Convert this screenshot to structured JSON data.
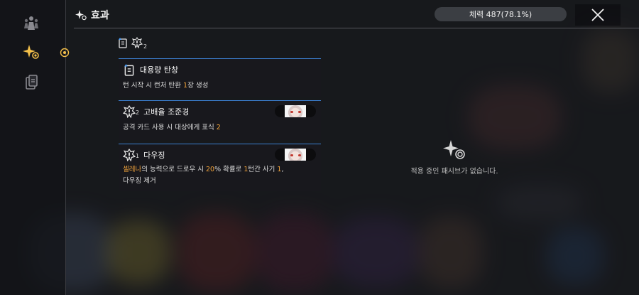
{
  "header": {
    "title": "효과",
    "hp_text": "체력 487(78.1%)",
    "close_icon": "close-x-icon"
  },
  "colors": {
    "accent_blue": "#3b7fd0",
    "highlight_orange": "#f0a23a",
    "active_gold": "#f4c04a"
  },
  "sidebar": {
    "items": [
      {
        "icon": "party-icon",
        "active": false
      },
      {
        "icon": "sparkle-effect-icon",
        "active": true
      },
      {
        "icon": "card-deck-icon",
        "active": false
      }
    ]
  },
  "summary": {
    "icons": [
      "scroll-card-icon",
      "exclamation-burst-icon"
    ],
    "count": "2"
  },
  "effects": [
    {
      "name": "대용량 탄창",
      "icon": "scroll-card-icon",
      "desc": {
        "pre": "턴 시작 시 런처 탄환 ",
        "num": "1",
        "post": "장 생성"
      }
    },
    {
      "name": "고배율 조준경",
      "icon": "exclamation-burst-icon",
      "icon_count": "2",
      "portrait": "white-haired-character-portrait",
      "desc": {
        "pre": "공격 카드 사용 시 대상에게 표식 ",
        "num": "2",
        "post": ""
      }
    },
    {
      "name": "다우징",
      "icon": "exclamation-burst-icon",
      "icon_count": "1",
      "portrait": "white-haired-character-portrait",
      "desc": {
        "name_hl": "셀레나",
        "t1": "의 능력으로 드로우 시 ",
        "pct": "20",
        "t2": "% 확률로 ",
        "turn": "1",
        "t3": "턴간 사기 ",
        "morale": "1",
        "t4": ",",
        "line2": "다우징 제거"
      }
    }
  ],
  "empty_state": {
    "icon": "sparkle-swirl-icon",
    "text": "적용 중인 패시브가 없습니다."
  }
}
